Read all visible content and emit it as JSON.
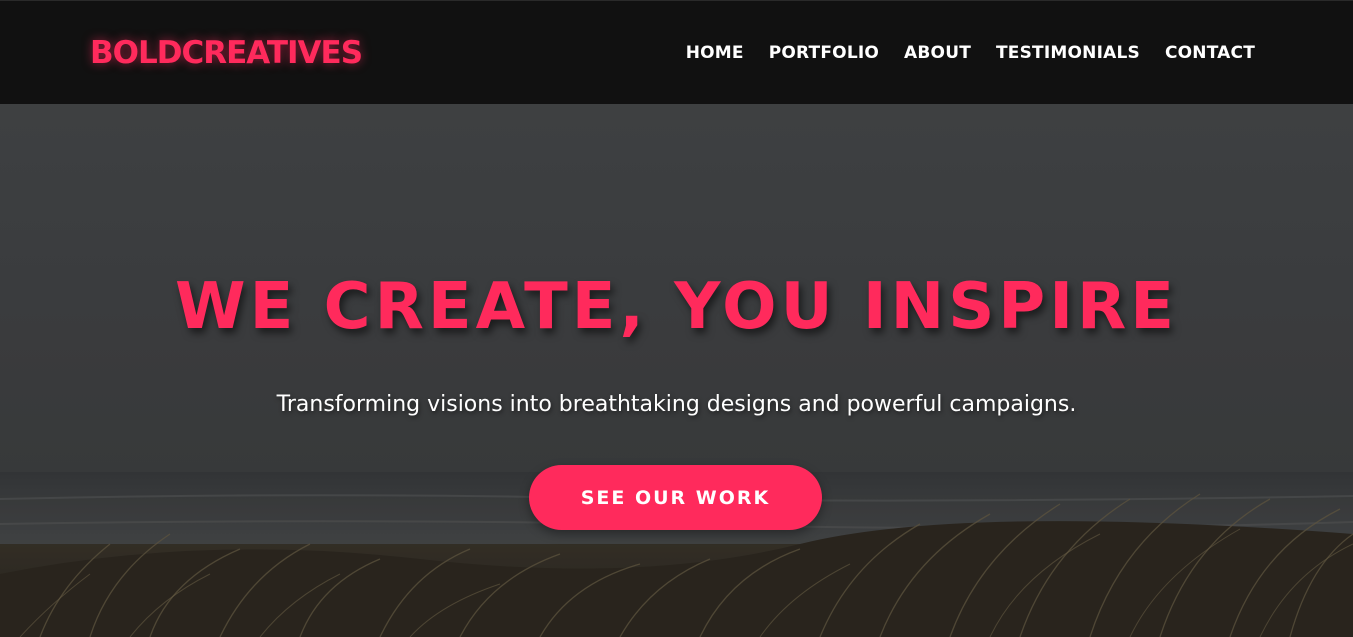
{
  "header": {
    "logo": "BOLDCREATIVES",
    "nav": [
      {
        "label": "HOME"
      },
      {
        "label": "PORTFOLIO"
      },
      {
        "label": "ABOUT"
      },
      {
        "label": "TESTIMONIALS"
      },
      {
        "label": "CONTACT"
      }
    ]
  },
  "hero": {
    "title": "WE CREATE, YOU INSPIRE",
    "subtitle": "Transforming visions into breathtaking designs and powerful campaigns.",
    "cta_label": "SEE OUR WORK"
  },
  "colors": {
    "accent": "#ff2a5c",
    "header_bg": "#111111",
    "text": "#ffffff"
  }
}
